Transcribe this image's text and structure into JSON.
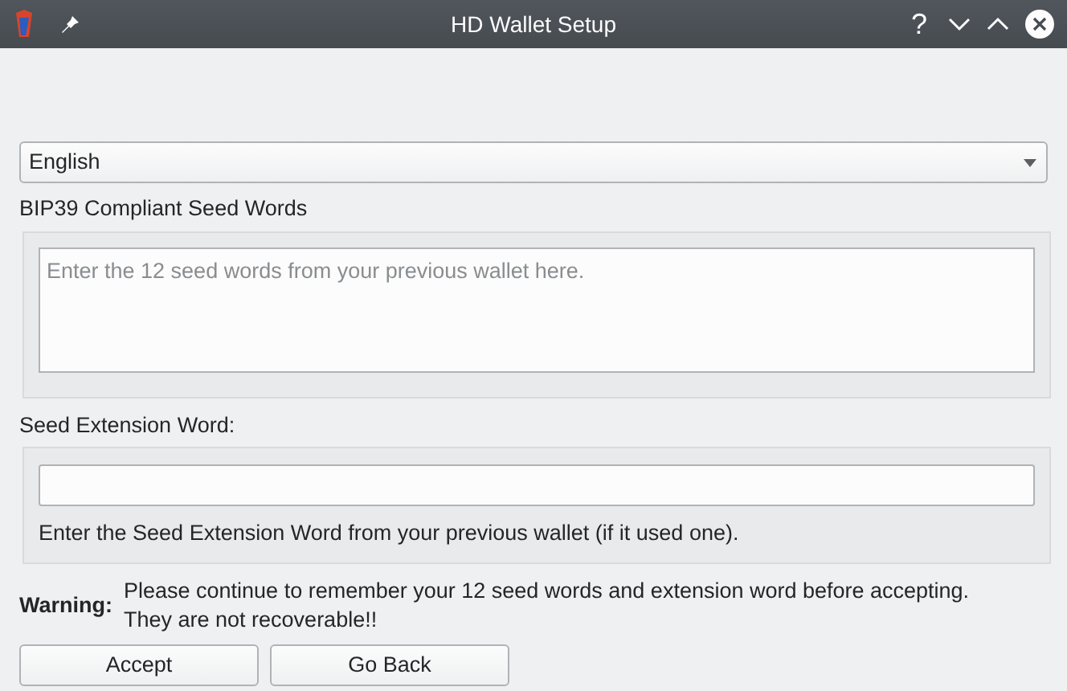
{
  "window": {
    "title": "HD Wallet Setup",
    "help": "?"
  },
  "language": {
    "value": "English"
  },
  "seed_words": {
    "label": "BIP39 Compliant Seed Words",
    "placeholder": "Enter the 12 seed words from your previous wallet here."
  },
  "seed_extension": {
    "label": "Seed Extension Word:",
    "hint": "Enter the Seed Extension Word from your previous wallet (if it used one)."
  },
  "warning": {
    "label": "Warning:",
    "lines": [
      "Please continue to remember your 12 seed words and extension word before accepting.",
      "They are not recoverable!!"
    ]
  },
  "buttons": [
    "Accept",
    "Go Back"
  ]
}
